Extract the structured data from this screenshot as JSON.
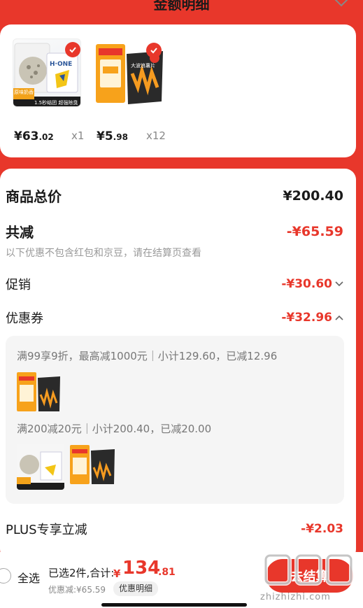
{
  "header": {
    "title": "金额明细"
  },
  "products": [
    {
      "thumb_badge": "原味奶香",
      "thumb_banner": "1.5秒结团 超强除臭",
      "price_main": "¥63",
      "price_dec": ".02",
      "qty": "x1"
    },
    {
      "thumb_banner": "大波浪薯片",
      "price_main": "¥5",
      "price_dec": ".98",
      "qty": "x12"
    }
  ],
  "breakdown": {
    "total_label": "商品总价",
    "total_value": "¥200.40",
    "discount_label": "共减",
    "discount_value": "-¥65.59",
    "note": "以下优惠不包含红包和京豆，请在结算页查看",
    "promo_label": "促销",
    "promo_value": "-¥30.60",
    "coupon_label": "优惠券",
    "coupon_value": "-¥32.96",
    "coupon_line1": "满99享9折，最高减1000元｜小计129.60，已减12.96",
    "coupon_line2": "满200减20元｜小计200.40，已减20.00",
    "plus_label": "PLUS专享立减",
    "plus_value": "-¥2.03"
  },
  "bottom": {
    "select_all": "全选",
    "summary": "已选2件,合计:",
    "total_symbol": "¥",
    "total_int": "134",
    "total_dec": ".81",
    "saved": "优惠减:¥65.59",
    "detail_button": "优惠明细",
    "checkout": "去结算",
    "watermark": "zhizhizhi.com"
  },
  "colors": {
    "accent": "#e8372b",
    "text": "#1a1a1a",
    "muted": "#999999"
  }
}
